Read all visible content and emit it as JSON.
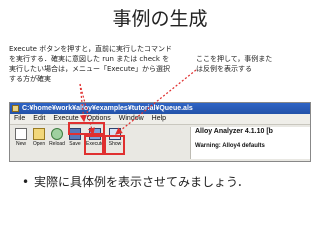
{
  "slide": {
    "title": "事例の生成",
    "note_left": "Execute ボタンを押すと，直前に実行したコマンドを実行する．確実に意図した run または check を実行したい場合は，メニュー「Execute」から選択する方が確実",
    "note_right": "ここを押して，事例または反例を表示する",
    "bullet": "実際に具体例を表示させてみましょう．"
  },
  "window": {
    "title": "C:¥home¥work¥alloy¥examples¥tutorial¥Queue.als",
    "menus": [
      "File",
      "Edit",
      "Execute",
      "Options",
      "Window",
      "Help"
    ],
    "tools": [
      {
        "label": "New",
        "icon": "new-file-icon"
      },
      {
        "label": "Open",
        "icon": "open-folder-icon"
      },
      {
        "label": "Reload",
        "icon": "reload-icon"
      },
      {
        "label": "Save",
        "icon": "save-disk-icon"
      },
      {
        "label": "Execute",
        "icon": "execute-icon"
      },
      {
        "label": "Show",
        "icon": "show-graph-icon"
      }
    ],
    "app_label": "Alloy Analyzer 4.1.10 [b",
    "warning_label": "Warning: Alloy4 defaults"
  },
  "colors": {
    "highlight": "#e03030",
    "titlebar": "#2352a8"
  }
}
